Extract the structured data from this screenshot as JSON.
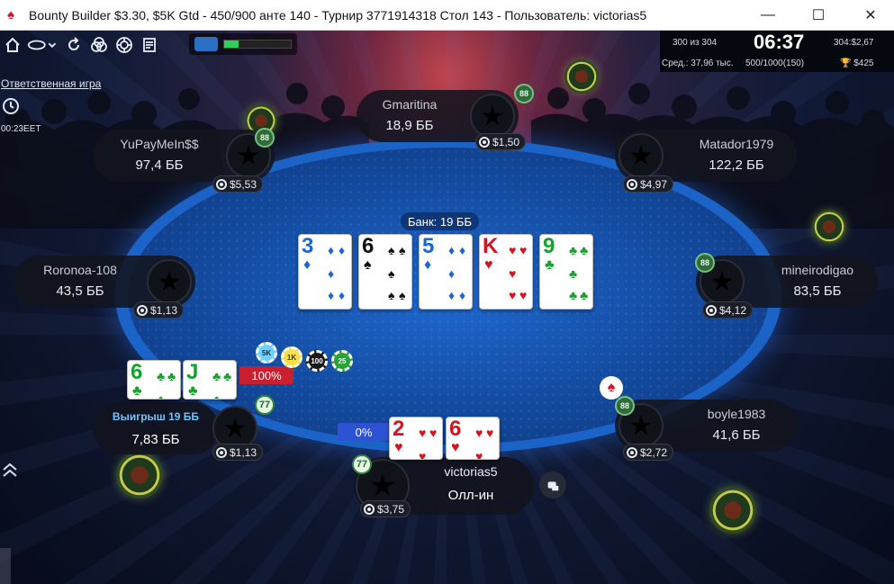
{
  "window": {
    "title": "Bounty Builder $3.30, $5K Gtd - 450/900 анте 140 - Турнир 3771914318 Стол 143 - Пользователь: victorias5",
    "minimize": "—",
    "maximize": "☐",
    "close": "✕"
  },
  "colors": {
    "felt": "#1c5fbf",
    "rail": "#1b63c6",
    "win_text": "#6fc3ff",
    "pct_red": "#c8202e",
    "pct_blue": "#2e52d4"
  },
  "toolbar": {
    "icons": [
      "home-icon",
      "chat-icon",
      "chevron-down-icon",
      "replay-icon",
      "cards-icon",
      "target-icon",
      "cashier-icon",
      "battery-icon"
    ],
    "battery_level": 0.22
  },
  "stats": {
    "position": "300 из 304",
    "timer": "06:37",
    "prize": "304:$2,67",
    "avg": "Сред.: 37,96 тыс.",
    "players": "500/1000(150)",
    "bounty_total": "🏆 $425"
  },
  "responsible_gaming": "Ответственная игра",
  "clock": {
    "time": "00:23EET"
  },
  "pot": {
    "label": "Банк: 19 ББ"
  },
  "board": [
    {
      "rank": "3",
      "suit": "♦",
      "color": "blue"
    },
    {
      "rank": "6",
      "suit": "♠",
      "color": "black"
    },
    {
      "rank": "5",
      "suit": "♦",
      "color": "blue"
    },
    {
      "rank": "K",
      "suit": "♥",
      "color": "red"
    },
    {
      "rank": "9",
      "suit": "♣",
      "color": "green"
    }
  ],
  "seats": [
    {
      "name": "Gmaritina",
      "stack": "18,9 ББ",
      "bounty": "$1,50"
    },
    {
      "name": "Matador1979",
      "stack": "122,2 ББ",
      "bounty": "$4,97"
    },
    {
      "name": "mineirodigao",
      "stack": "83,5 ББ",
      "bounty": "$4,12"
    },
    {
      "name": "boyle1983",
      "stack": "41,6 ББ",
      "bounty": "$2,72"
    },
    {
      "name": "Roronoa-108",
      "stack": "43,5 ББ",
      "bounty": "$1,13"
    },
    {
      "name": "YuPayMeIn$$",
      "stack": "97,4 ББ",
      "bounty": "$5,53"
    }
  ],
  "winner": {
    "label": "Выигрыш 19 ББ",
    "stack": "7,83 ББ",
    "bounty": "$1,13",
    "percent": "100%",
    "cards": [
      {
        "rank": "6",
        "suit": "♣",
        "color": "green"
      },
      {
        "rank": "J",
        "suit": "♣",
        "color": "green"
      }
    ]
  },
  "chips": [
    "5K",
    "1K",
    "100",
    "25"
  ],
  "hero": {
    "name": "victorias5",
    "status": "Олл-ин",
    "bounty": "$3,75",
    "percent": "0%",
    "cards": [
      {
        "rank": "2",
        "suit": "♥",
        "color": "red"
      },
      {
        "rank": "6",
        "suit": "♥",
        "color": "red"
      }
    ]
  },
  "badges": {
    "b88": "88",
    "b77": "77"
  }
}
